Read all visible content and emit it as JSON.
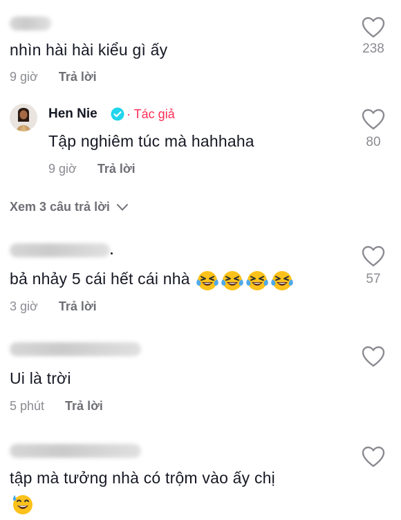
{
  "comments": [
    {
      "text": "nhìn hài hài kiểu gì ấy",
      "time": "9 giờ",
      "reply_label": "Trả lời",
      "likes": "238",
      "reply": {
        "author": "Hen Nie",
        "author_tag": "Tác giả",
        "text": "Tập nghiêm túc mà hahhaha",
        "time": "9 giờ",
        "reply_label": "Trả lời",
        "likes": "80"
      },
      "view_replies": "Xem 3 câu trả lời"
    },
    {
      "text": "bả nhảy 5 cái hết cái nhà",
      "emoji": [
        "laughing-tears-emoji",
        "laughing-tears-emoji",
        "laughing-tears-emoji",
        "laughing-tears-emoji"
      ],
      "time": "3 giờ",
      "reply_label": "Trả lời",
      "likes": "57"
    },
    {
      "text": "Ui là trời",
      "time": "5 phút",
      "reply_label": "Trả lời"
    },
    {
      "text": "tập mà tưởng nhà có trộm vào ấy chị",
      "emoji": [
        "sweat-smile-emoji"
      ]
    }
  ],
  "icons": {
    "like": "heart-outline-icon",
    "verified": "verified-badge-icon",
    "chevron": "chevron-down-icon"
  },
  "colors": {
    "author_tag": "#fe2c55",
    "verified": "#20d5ec",
    "muted_text": "#8a8b91"
  }
}
